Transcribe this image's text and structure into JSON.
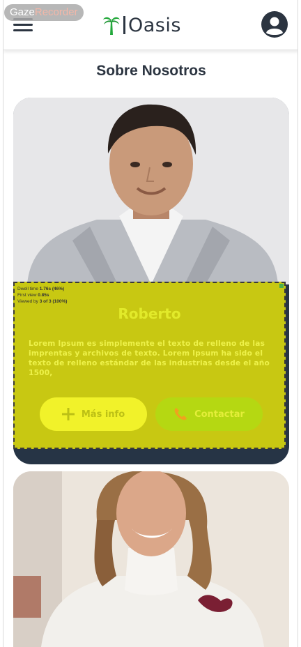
{
  "recorder": {
    "part1": "Gaze",
    "part2": "Recorder"
  },
  "header": {
    "logo_text": "Oasis"
  },
  "page": {
    "title": "Sobre Nosotros"
  },
  "gaze_stats": {
    "dwell_label": "Dwell time",
    "dwell_value": "1.76s (46%)",
    "first_view_label": "First view",
    "first_view_value": "0.85s",
    "viewed_label": "Viewed by",
    "viewed_value": "3 of 3 (100%)"
  },
  "profiles": [
    {
      "name": "Roberto",
      "description": "Lorem Ipsum es simplemente el texto de relleno de las imprentas y archivos de texto. Lorem Ipsum ha sido el texto de relleno estándar de las industrias desde el año 1500,",
      "info_label": "Más info",
      "contact_label": "Contactar"
    },
    {
      "name": ""
    }
  ],
  "colors": {
    "brand_dark": "#263445",
    "overlay": "#c8c812",
    "button_info": "#f1f22a",
    "button_contact": "#b5d812"
  },
  "icons": [
    "menu-icon",
    "palm-logo-icon",
    "account-icon",
    "plus-icon",
    "phone-icon"
  ]
}
